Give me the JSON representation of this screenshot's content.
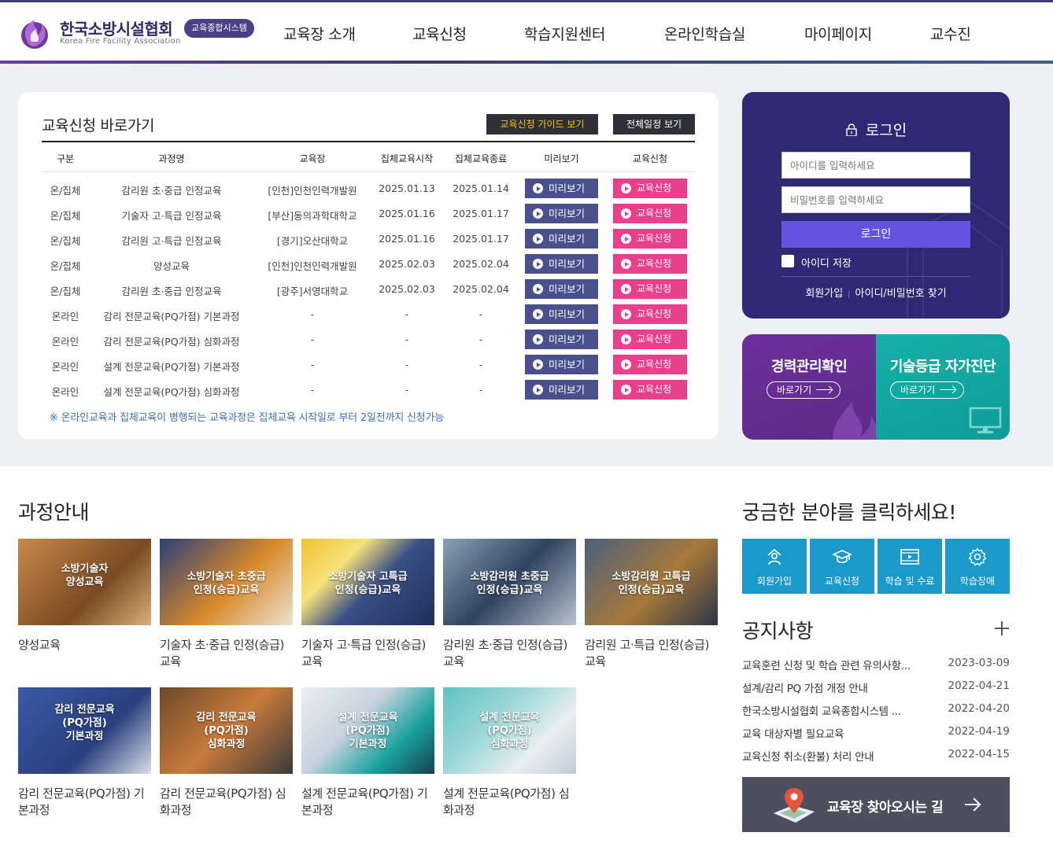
{
  "header": {
    "logo_title": "한국소방시설협회",
    "logo_sub": "Korea Fire Facility Association",
    "logo_badge": "교육종합시스템",
    "nav": [
      "교육장 소개",
      "교육신청",
      "학습지원센터",
      "온라인학습실",
      "마이페이지",
      "교수진"
    ]
  },
  "shortcut": {
    "title": "교육신청 바로가기",
    "guide_button": "교육신청 가이드 보기",
    "schedule_button": "전체일정 보기",
    "columns": [
      "구분",
      "과정명",
      "교육장",
      "집체교육시작",
      "집체교육종료",
      "미리보기",
      "교육신청"
    ],
    "preview_label": "미리보기",
    "apply_label": "교육신청",
    "rows": [
      [
        "온/집체",
        "감리원 초·중급 인정교육",
        "[인천]인천인력개발원",
        "2025.01.13",
        "2025.01.14"
      ],
      [
        "온/집체",
        "기술자 고·특급 인정교육",
        "[부산]동의과학대학교",
        "2025.01.16",
        "2025.01.17"
      ],
      [
        "온/집체",
        "감리원 고·특급 인정교육",
        "[경기]오산대학교",
        "2025.01.16",
        "2025.01.17"
      ],
      [
        "온/집체",
        "양성교육",
        "[인천]인천인력개발원",
        "2025.02.03",
        "2025.02.04"
      ],
      [
        "온/집체",
        "감리원 초·중급 인정교육",
        "[광주]서영대학교",
        "2025.02.03",
        "2025.02.04"
      ],
      [
        "온라인",
        "감리 전문교육(PQ가점) 기본과정",
        "-",
        "-",
        "-"
      ],
      [
        "온라인",
        "감리 전문교육(PQ가점) 심화과정",
        "-",
        "-",
        "-"
      ],
      [
        "온라인",
        "설계 전문교육(PQ가점) 기본과정",
        "-",
        "-",
        "-"
      ],
      [
        "온라인",
        "설계 전문교육(PQ가점) 심화과정",
        "-",
        "-",
        "-"
      ]
    ],
    "note": "※ 온라인교육과 집체교육이 병행되는 교육과정은 집체교육 시작일로 부터 2일전까지 신청가능"
  },
  "login": {
    "title": "로그인",
    "id_placeholder": "아이디를 입력하세요",
    "pw_placeholder": "비밀번호를 입력하세요",
    "button": "로그인",
    "save_id": "아이디 저장",
    "join": "회원가입",
    "separator": "|",
    "find": "아이디/비밀번호 찾기"
  },
  "promos": [
    {
      "title": "경력관리확인",
      "link": "바로가기"
    },
    {
      "title": "기술등급 자가진단",
      "link": "바로가기"
    }
  ],
  "courses": {
    "title": "과정안내",
    "items": [
      {
        "thumb": [
          "소방기술자",
          "양성교육"
        ],
        "caption": "양성교육"
      },
      {
        "thumb": [
          "소방기술자 초중급",
          "인정(승급)교육"
        ],
        "caption": "기술자 초·중급 인정(승급) 교육"
      },
      {
        "thumb": [
          "소방기술자 고특급",
          "인정(승급)교육"
        ],
        "caption": "기술자 고·특급 인정(승급) 교육"
      },
      {
        "thumb": [
          "소방감리원 초중급",
          "인정(승급)교육"
        ],
        "caption": "감리원 초·중급 인정(승급) 교육"
      },
      {
        "thumb": [
          "소방감리원 고특급",
          "인정(승급)교육"
        ],
        "caption": "감리원 고·특급 인정(승급) 교육"
      },
      {
        "thumb": [
          "감리 전문교육",
          "(PQ가점)",
          "기본과정"
        ],
        "caption": "감리 전문교육(PQ가점) 기본과정"
      },
      {
        "thumb": [
          "감리 전문교육",
          "(PQ가점)",
          "심화과정"
        ],
        "caption": "감리 전문교육(PQ가점) 심화과정"
      },
      {
        "thumb": [
          "설계 전문교육",
          "(PQ가점)",
          "기본과정"
        ],
        "caption": "설계 전문교육(PQ가점) 기본과정"
      },
      {
        "thumb": [
          "설계 전문교육",
          "(PQ가점)",
          "심화과정"
        ],
        "caption": "설계 전문교육(PQ가점) 심화과정"
      }
    ]
  },
  "quick": {
    "title": "궁금한 분야를 클릭하세요!",
    "tiles": [
      {
        "label": "회원가입",
        "icon": "member-icon"
      },
      {
        "label": "교육신청",
        "icon": "graduation-cap-icon"
      },
      {
        "label": "학습 및 수료",
        "icon": "film-icon"
      },
      {
        "label": "학습장애",
        "icon": "gear-icon"
      }
    ]
  },
  "notices": {
    "title": "공지사항",
    "items": [
      {
        "title": "교육훈련 신청 및 학습 관련 유의사항...",
        "date": "2023-03-09"
      },
      {
        "title": "설계/감리 PQ 가점 개정 안내",
        "date": "2022-04-21"
      },
      {
        "title": "한국소방시설협회 교육종합시스템 ...",
        "date": "2022-04-20"
      },
      {
        "title": "교육 대상자별 필요교육",
        "date": "2022-04-19"
      },
      {
        "title": "교육신청 취소(환불) 처리 안내",
        "date": "2022-04-15"
      }
    ]
  },
  "directions": {
    "label": "교육장 찾아오시는 길"
  },
  "colors": {
    "navy": "#2d2975",
    "purple_btn": "#4a4f8e",
    "pink_btn": "#e8408d",
    "teal": "#17b0a8",
    "tile_blue": "#1a9ac8"
  }
}
